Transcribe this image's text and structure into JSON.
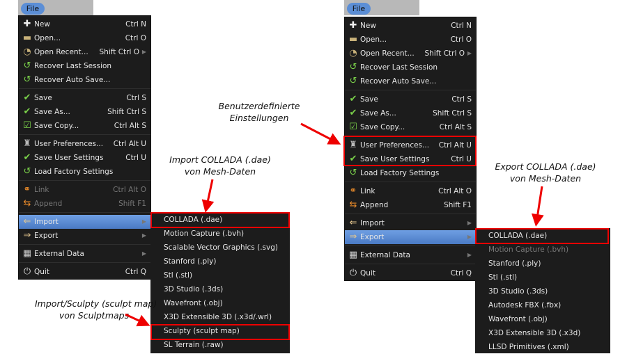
{
  "file_label": "File",
  "menu_items": [
    {
      "label": "New",
      "shortcut": "Ctrl N",
      "icon": "new-file-icon",
      "glyph": "✚",
      "color": "#eee"
    },
    {
      "label": "Open...",
      "shortcut": "Ctrl O",
      "icon": "folder-icon",
      "glyph": "▬",
      "color": "#c9b27a"
    },
    {
      "label": "Open Recent...",
      "shortcut": "Shift Ctrl O",
      "icon": "open-recent-icon",
      "glyph": "◔",
      "color": "#c9b27a",
      "submenu": true
    },
    {
      "label": "Recover Last Session",
      "shortcut": "",
      "icon": "recover-session-icon",
      "glyph": "↺",
      "color": "#7bd24a"
    },
    {
      "label": "Recover Auto Save...",
      "shortcut": "",
      "icon": "recover-auto-save-icon",
      "glyph": "↺",
      "color": "#7bd24a"
    },
    {
      "label": "Save",
      "shortcut": "Ctrl S",
      "icon": "checkmark-icon",
      "glyph": "✔",
      "color": "#7bd24a",
      "sepBefore": true
    },
    {
      "label": "Save As...",
      "shortcut": "Shift Ctrl S",
      "icon": "save-as-icon",
      "glyph": "✔",
      "color": "#7bd24a"
    },
    {
      "label": "Save Copy...",
      "shortcut": "Ctrl Alt S",
      "icon": "save-copy-icon",
      "glyph": "☑",
      "color": "#7bd24a"
    },
    {
      "label": "User Preferences...",
      "shortcut": "Ctrl Alt U",
      "icon": "preferences-icon",
      "glyph": "♜",
      "color": "#bbb",
      "sepBefore": true
    },
    {
      "label": "Save User Settings",
      "shortcut": "Ctrl U",
      "icon": "save-settings-icon",
      "glyph": "✔",
      "color": "#7bd24a"
    },
    {
      "label": "Load Factory Settings",
      "shortcut": "",
      "icon": "load-factory-icon",
      "glyph": "↺",
      "color": "#7bd24a"
    },
    {
      "label": "Link",
      "shortcut": "Ctrl Alt O",
      "icon": "link-icon",
      "glyph": "⚭",
      "color": "#e88a2a",
      "sepBefore": true
    },
    {
      "label": "Append",
      "shortcut": "Shift F1",
      "icon": "append-icon",
      "glyph": "⇆",
      "color": "#e88a2a"
    },
    {
      "label": "Import",
      "shortcut": "",
      "icon": "import-icon",
      "glyph": "⇐",
      "color": "#e6c890",
      "submenu": true,
      "sepBefore": true
    },
    {
      "label": "Export",
      "shortcut": "",
      "icon": "export-icon",
      "glyph": "⇒",
      "color": "#e6c890",
      "submenu": true
    },
    {
      "label": "External Data",
      "shortcut": "",
      "icon": "external-data-icon",
      "glyph": "▦",
      "color": "#ccc",
      "submenu": true,
      "sepBefore": true
    },
    {
      "label": "Quit",
      "shortcut": "Ctrl Q",
      "icon": "power-icon",
      "glyph": "⏻",
      "color": "#ddd",
      "sepBefore": true
    }
  ],
  "left_menu": {
    "highlighted": "Import",
    "disabled": [
      "Link",
      "Append"
    ]
  },
  "right_menu": {
    "highlighted": "Export",
    "disabled": []
  },
  "import_submenu": [
    "COLLADA (.dae)",
    "Motion Capture (.bvh)",
    "Scalable Vector Graphics (.svg)",
    "Stanford (.ply)",
    "Stl (.stl)",
    "3D Studio (.3ds)",
    "Wavefront (.obj)",
    "X3D Extensible 3D (.x3d/.wrl)",
    "Sculpty (sculpt map)",
    "SL Terrain (.raw)"
  ],
  "export_submenu": [
    "COLLADA (.dae)",
    "Motion Capture (.bvh)",
    "Stanford (.ply)",
    "Stl (.stl)",
    "3D Studio (.3ds)",
    "Autodesk FBX (.fbx)",
    "Wavefront (.obj)",
    "X3D Extensible 3D (.x3d)",
    "LLSD Primitives (.xml)"
  ],
  "export_disabled": [
    "Motion Capture (.bvh)"
  ],
  "annotations": {
    "import_collada": [
      "Import COLLADA (.dae)",
      "von Mesh-Daten"
    ],
    "sculpty": [
      "Import/Sculpty (sculpt map)",
      "von Sculptmaps"
    ],
    "user_settings": [
      "Benutzerdefinierte",
      "Einstellungen"
    ],
    "export_collada": [
      "Export COLLADA (.dae)",
      "von Mesh-Daten"
    ]
  },
  "colors": {
    "menu_bg": "#1c1c1c",
    "highlight": "#5b8ed6",
    "annotation_red": "#ee0000"
  }
}
